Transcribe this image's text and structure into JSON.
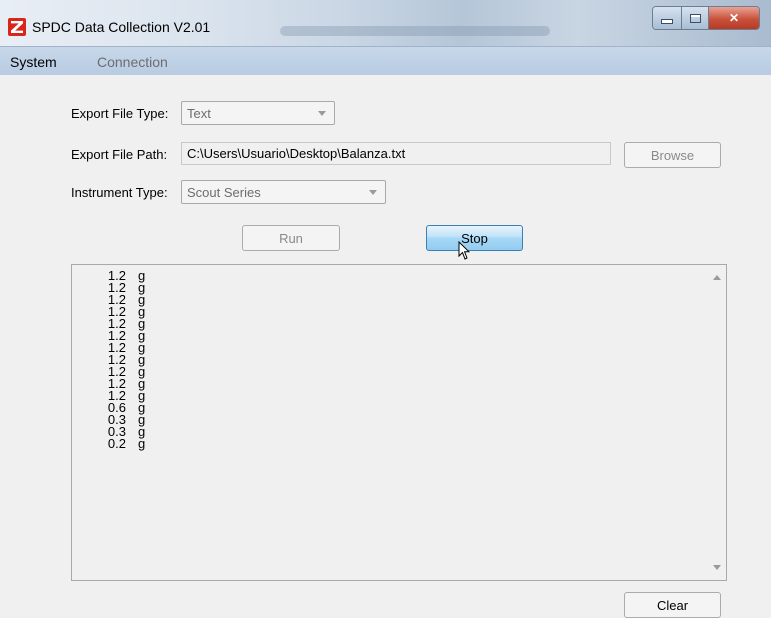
{
  "window": {
    "title": "SPDC Data Collection  V2.01"
  },
  "menu": {
    "system": "System",
    "connection": "Connection"
  },
  "form": {
    "export_type_label": "Export File Type:",
    "export_type_value": "Text",
    "export_path_label": "Export File Path:",
    "export_path_value": "C:\\Users\\Usuario\\Desktop\\Balanza.txt",
    "browse_label": "Browse",
    "instrument_label": "Instrument Type:",
    "instrument_value": "Scout Series"
  },
  "buttons": {
    "run": "Run",
    "stop": "Stop",
    "clear": "Clear"
  },
  "readings": [
    {
      "value": "1.2",
      "unit": "g"
    },
    {
      "value": "1.2",
      "unit": "g"
    },
    {
      "value": "1.2",
      "unit": "g"
    },
    {
      "value": "1.2",
      "unit": "g"
    },
    {
      "value": "1.2",
      "unit": "g"
    },
    {
      "value": "1.2",
      "unit": "g"
    },
    {
      "value": "1.2",
      "unit": "g"
    },
    {
      "value": "1.2",
      "unit": "g"
    },
    {
      "value": "1.2",
      "unit": "g"
    },
    {
      "value": "1.2",
      "unit": "g"
    },
    {
      "value": "1.2",
      "unit": "g"
    },
    {
      "value": "0.6",
      "unit": "g"
    },
    {
      "value": "0.3",
      "unit": "g"
    },
    {
      "value": "0.3",
      "unit": "g"
    },
    {
      "value": "0.2",
      "unit": "g"
    }
  ],
  "icons": {
    "app": "ohaus-logo-icon",
    "minimize": "minimize-icon",
    "maximize": "maximize-icon",
    "close": "close-icon",
    "cursor": "mouse-pointer-icon"
  },
  "colors": {
    "close_button": "#c9513c",
    "stop_button": "#a7d8f6",
    "menubar": "#c8d8ea"
  }
}
